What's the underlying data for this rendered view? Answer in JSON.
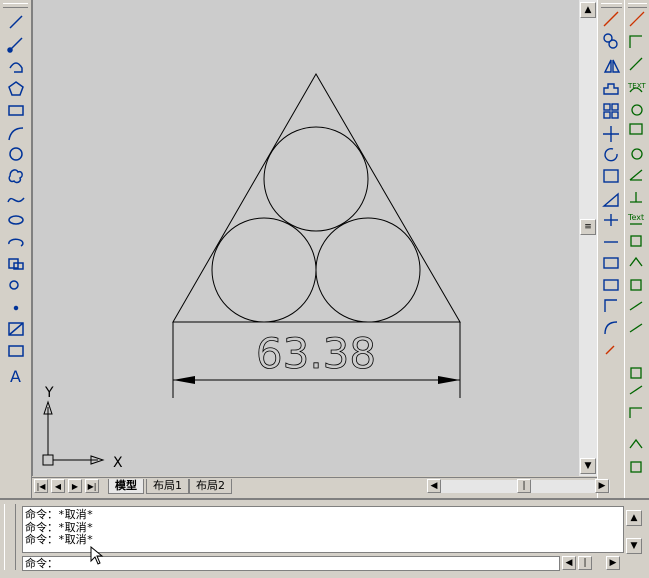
{
  "tabs": [
    {
      "label": "模型"
    },
    {
      "label": "布局1"
    },
    {
      "label": "布局2"
    }
  ],
  "drawing": {
    "dimension_text": "63.38",
    "ucs_x": "X",
    "ucs_y": "Y"
  },
  "command": {
    "history": [
      "命令：*取消*",
      "命令：*取消*",
      "命令：*取消*"
    ],
    "prompt": "命令："
  },
  "colors": {
    "canvas": "#cccccc",
    "ui": "#d4d0c8",
    "icon_blue": "#003399"
  }
}
